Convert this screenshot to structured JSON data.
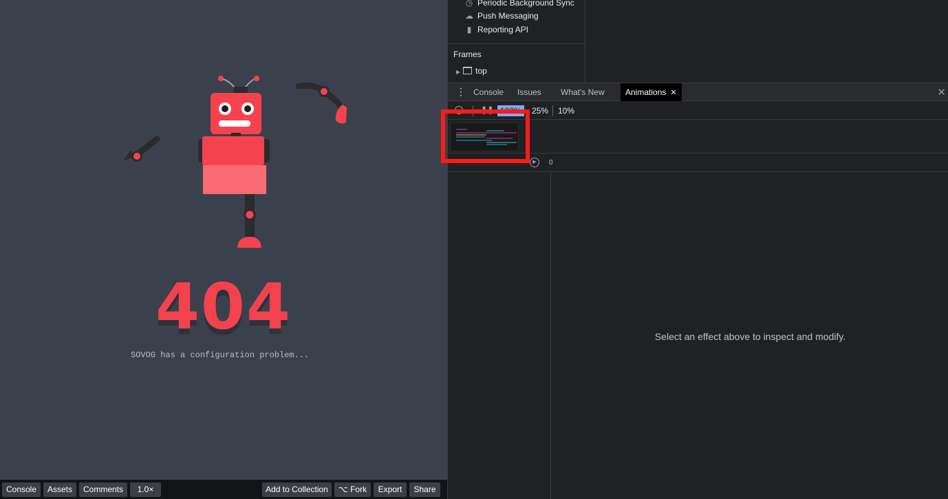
{
  "preview": {
    "error_code": "404",
    "error_message": "SOVOG has a configuration problem...",
    "robot_colors": {
      "body": "#f5424f",
      "body_light": "#f96a72",
      "limb": "#2b2b2e",
      "joint": "#f5424f"
    }
  },
  "bottom_bar": {
    "console": "Console",
    "assets": "Assets",
    "comments": "Comments",
    "zoom": "1.0×",
    "add_to_collection": "Add to Collection",
    "fork": "Fork",
    "export": "Export",
    "share": "Share"
  },
  "app_tree": {
    "items": [
      {
        "icon": "clock-icon",
        "glyph": "◷",
        "label": "Periodic Background Sync"
      },
      {
        "icon": "cloud-icon",
        "glyph": "☁",
        "label": "Push Messaging"
      },
      {
        "icon": "document-icon",
        "glyph": "▮",
        "label": "Reporting API"
      }
    ],
    "frames_label": "Frames",
    "top_frame": "top"
  },
  "drawer": {
    "tabs": [
      {
        "label": "Console"
      },
      {
        "label": "Issues"
      },
      {
        "label": "What's New"
      },
      {
        "label": "Animations",
        "active": true
      }
    ]
  },
  "animations": {
    "speeds": [
      "100%",
      "25%",
      "10%"
    ],
    "selected_speed": "100%",
    "time_start": "0",
    "empty_message": "Select an effect above to inspect and modify."
  },
  "accent_colors": {
    "highlight": "#ff1a1a",
    "speed_selected": "#7cacf8"
  }
}
